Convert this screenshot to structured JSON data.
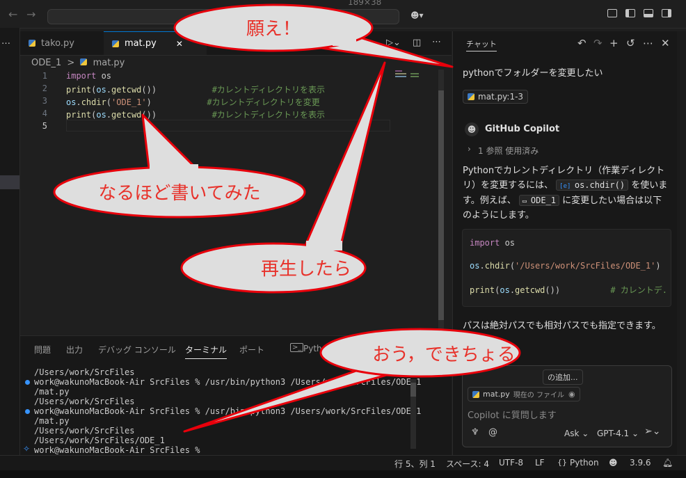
{
  "titlebar": {
    "back": "←",
    "forward": "→",
    "title_fragment": "189×38"
  },
  "tabs": [
    {
      "label": "tako.py"
    },
    {
      "label": "mat.py"
    }
  ],
  "tab_close": "✕",
  "breadcrumb": {
    "folder": "ODE_1",
    "sep": ">",
    "file": "mat.py"
  },
  "editor": {
    "line_numbers": [
      "1",
      "2",
      "3",
      "4",
      "5"
    ],
    "lines": [
      {
        "kw": "import",
        "rest": " os"
      },
      {
        "fn": "print",
        "open": "(",
        "id": "os",
        "mid": ".",
        "fn2": "getcwd",
        "close": "())",
        "pad": "           ",
        "comment": "#カレントディレクトリを表示"
      },
      {
        "id": "os",
        "mid": ".",
        "fn": "chdir",
        "open": "(",
        "str": "'ODE_1'",
        "close": ")",
        "pad": "           ",
        "comment": "#カレントディレクトリを変更"
      },
      {
        "fn": "print",
        "open": "(",
        "id": "os",
        "mid": ".",
        "fn2": "getcwd",
        "close": "())",
        "pad": "           ",
        "comment": "#カレントディレクトリを表示"
      }
    ]
  },
  "panel": {
    "tabs": [
      "問題",
      "出力",
      "デバッグ コンソール",
      "ターミナル",
      "ポート",
      "Pytho"
    ],
    "terminal": [
      "/Users/work/SrcFiles",
      "work@wakunoMacBook-Air SrcFiles % /usr/bin/python3 /Users/work/SrcFiles/ODE_1",
      "/mat.py",
      "/Users/work/SrcFiles",
      "work@wakunoMacBook-Air SrcFiles % /usr/bin/python3 /Users/work/SrcFiles/ODE_1",
      "/mat.py",
      "/Users/work/SrcFiles",
      "/Users/work/SrcFiles/ODE_1",
      "work@wakunoMacBook-Air SrcFiles %"
    ]
  },
  "chat": {
    "title": "チャット",
    "user_message": "pythonでフォルダーを変更したい",
    "context_chip": "mat.py:1-3",
    "assistant_name": "GitHub Copilot",
    "references": "1 参照 使用済み",
    "answer_part1": "Pythonでカレントディレクトリ（作業ディレクトリ）を変更するには、",
    "answer_code1": "os.chdir()",
    "answer_part2": "を使います。例えば、",
    "answer_code2": "ODE_1",
    "answer_part3": "に変更したい場合は以下のようにします。",
    "code_lines": [
      {
        "kw": "import",
        "rest": " os"
      },
      {
        "id": "os",
        "mid": ".",
        "fn": "chdir",
        "open": "(",
        "str": "'/Users/work/SrcFiles/ODE_1'",
        "close": ")"
      },
      {
        "fn": "print",
        "open": "(",
        "id": "os",
        "mid": ".",
        "fn2": "getcwd",
        "close": "())",
        "pad": "          ",
        "comment": "# カレントデ."
      }
    ],
    "answer_footer": "パスは絶対パスでも相対パスでも指定できます。",
    "add_context": "の追加...",
    "file_chip_name": "mat.py",
    "file_chip_desc": "現在の ファイル",
    "input_placeholder": "Copilot に質問します",
    "mode": "Ask",
    "model": "GPT-4.1"
  },
  "statusbar": {
    "position": "行 5、列 1",
    "spaces": "スペース: 4",
    "encoding": "UTF-8",
    "eol": "LF",
    "language": "Python",
    "braces": "{}",
    "version": "3.9.6"
  },
  "bubbles": {
    "wish": "願え！",
    "tried": "なるほど書いてみた",
    "played": "再生したら",
    "worked": "おう，できちょる"
  },
  "colors": {
    "bubble_fill": "#dedede",
    "bubble_stroke": "#e8000b",
    "bubble_text": "#e8312a",
    "accent": "#0078d4"
  }
}
